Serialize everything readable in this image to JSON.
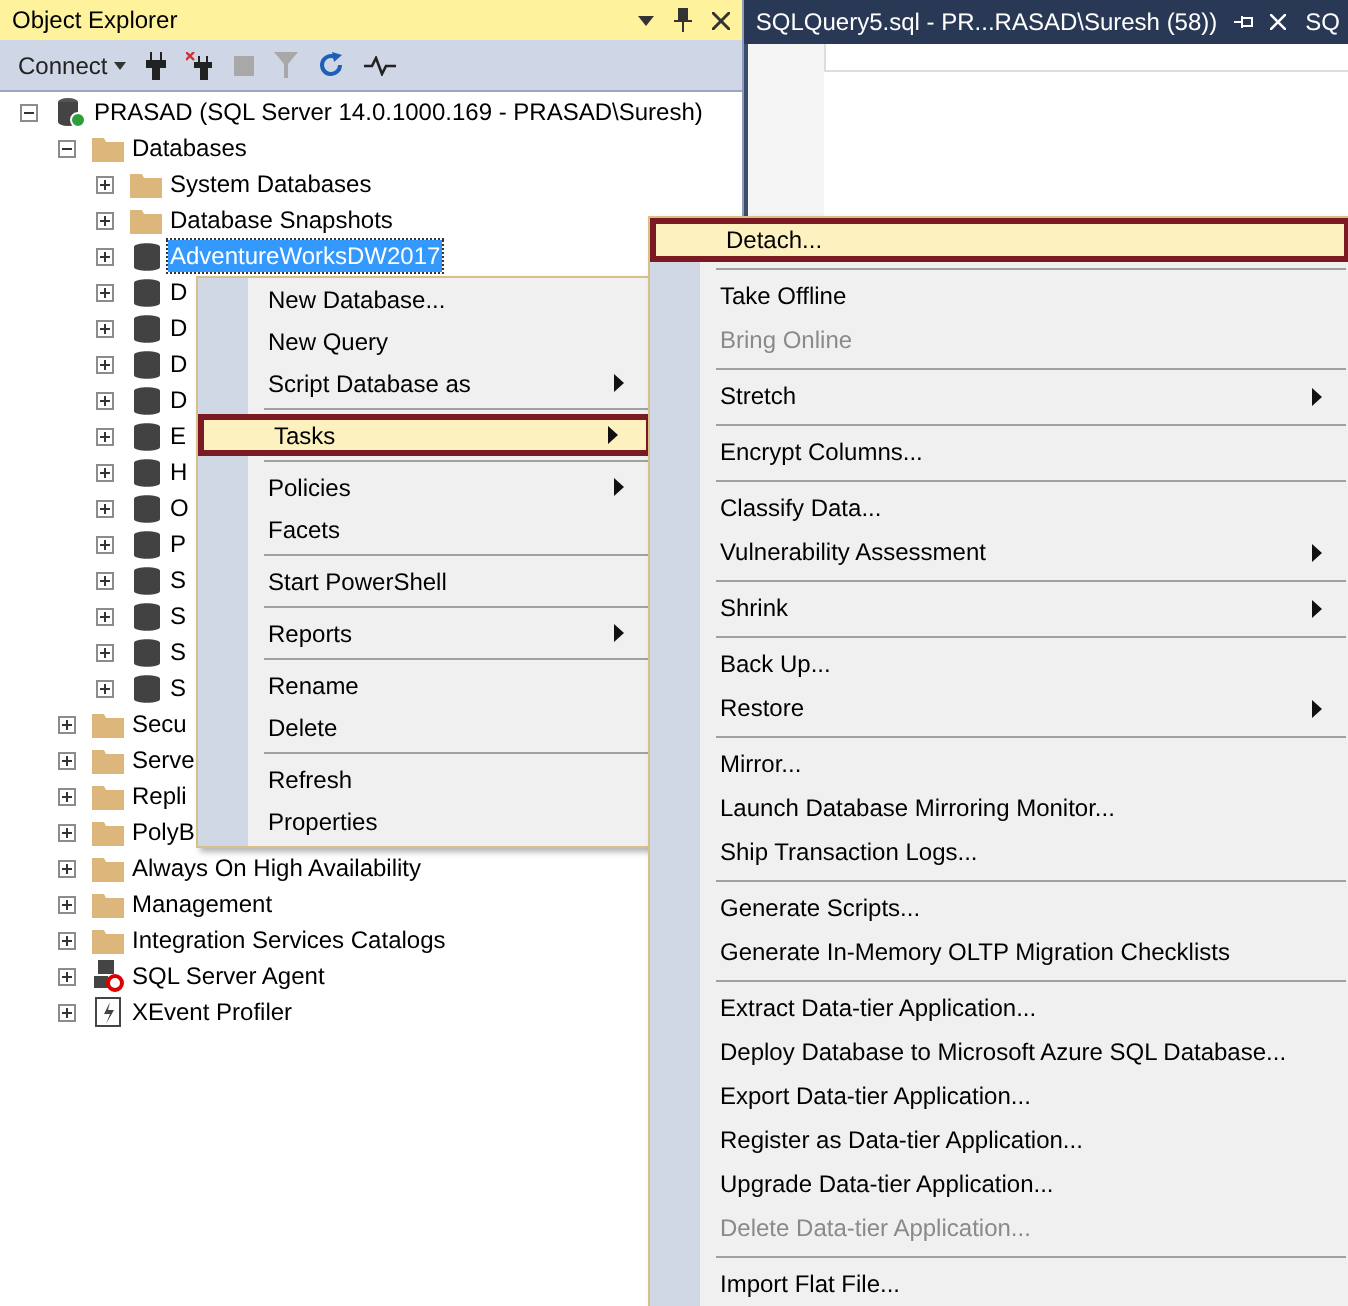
{
  "object_explorer": {
    "title": "Object Explorer",
    "connect": "Connect",
    "tree": [
      {
        "label": "PRASAD (SQL Server 14.0.1000.169 - PRASAD\\Suresh)",
        "kind": "server",
        "expanded": true,
        "selected": false,
        "children": [
          {
            "label": "Databases",
            "kind": "folder",
            "expanded": true,
            "selected": false,
            "children": [
              {
                "label": "System Databases",
                "kind": "folder",
                "expanded": false,
                "selected": false
              },
              {
                "label": "Database Snapshots",
                "kind": "folder",
                "expanded": false,
                "selected": false
              },
              {
                "label": "AdventureWorksDW2017",
                "kind": "database",
                "expanded": false,
                "selected": true
              },
              {
                "label": "D",
                "kind": "database",
                "expanded": false,
                "selected": false
              },
              {
                "label": "D",
                "kind": "database",
                "expanded": false,
                "selected": false
              },
              {
                "label": "D",
                "kind": "database",
                "expanded": false,
                "selected": false
              },
              {
                "label": "D",
                "kind": "database",
                "expanded": false,
                "selected": false
              },
              {
                "label": "E",
                "kind": "database",
                "expanded": false,
                "selected": false
              },
              {
                "label": "H",
                "kind": "database",
                "expanded": false,
                "selected": false
              },
              {
                "label": "O",
                "kind": "database",
                "expanded": false,
                "selected": false
              },
              {
                "label": "P",
                "kind": "database",
                "expanded": false,
                "selected": false
              },
              {
                "label": "S",
                "kind": "database",
                "expanded": false,
                "selected": false
              },
              {
                "label": "S",
                "kind": "database",
                "expanded": false,
                "selected": false
              },
              {
                "label": "S",
                "kind": "database",
                "expanded": false,
                "selected": false
              },
              {
                "label": "S",
                "kind": "database",
                "expanded": false,
                "selected": false
              }
            ]
          },
          {
            "label": "Secu",
            "kind": "folder",
            "expanded": false,
            "selected": false
          },
          {
            "label": "Serve",
            "kind": "folder",
            "expanded": false,
            "selected": false
          },
          {
            "label": "Repli",
            "kind": "folder",
            "expanded": false,
            "selected": false
          },
          {
            "label": "PolyB",
            "kind": "folder",
            "expanded": false,
            "selected": false
          },
          {
            "label": "Always On High Availability",
            "kind": "folder",
            "expanded": false,
            "selected": false
          },
          {
            "label": "Management",
            "kind": "folder",
            "expanded": false,
            "selected": false
          },
          {
            "label": "Integration Services Catalogs",
            "kind": "folder",
            "expanded": false,
            "selected": false
          },
          {
            "label": "SQL Server Agent",
            "kind": "agent",
            "expanded": false,
            "selected": false
          },
          {
            "label": "XEvent Profiler",
            "kind": "xevent",
            "expanded": false,
            "selected": false
          }
        ]
      }
    ]
  },
  "editor_tabs": [
    {
      "label": "SQLQuery5.sql - PR...RASAD\\Suresh (58))"
    },
    {
      "label": "SQ"
    }
  ],
  "context_menu": [
    {
      "kind": "item",
      "label": "New Database...",
      "submenu": false,
      "selected": false,
      "disabled": false
    },
    {
      "kind": "item",
      "label": "New Query",
      "submenu": false,
      "selected": false,
      "disabled": false
    },
    {
      "kind": "item",
      "label": "Script Database as",
      "submenu": true,
      "selected": false,
      "disabled": false
    },
    {
      "kind": "separator"
    },
    {
      "kind": "item",
      "label": "Tasks",
      "submenu": true,
      "selected": true,
      "disabled": false
    },
    {
      "kind": "separator"
    },
    {
      "kind": "item",
      "label": "Policies",
      "submenu": true,
      "selected": false,
      "disabled": false
    },
    {
      "kind": "item",
      "label": "Facets",
      "submenu": false,
      "selected": false,
      "disabled": false
    },
    {
      "kind": "separator"
    },
    {
      "kind": "item",
      "label": "Start PowerShell",
      "submenu": false,
      "selected": false,
      "disabled": false
    },
    {
      "kind": "separator"
    },
    {
      "kind": "item",
      "label": "Reports",
      "submenu": true,
      "selected": false,
      "disabled": false
    },
    {
      "kind": "separator"
    },
    {
      "kind": "item",
      "label": "Rename",
      "submenu": false,
      "selected": false,
      "disabled": false
    },
    {
      "kind": "item",
      "label": "Delete",
      "submenu": false,
      "selected": false,
      "disabled": false
    },
    {
      "kind": "separator"
    },
    {
      "kind": "item",
      "label": "Refresh",
      "submenu": false,
      "selected": false,
      "disabled": false
    },
    {
      "kind": "item",
      "label": "Properties",
      "submenu": false,
      "selected": false,
      "disabled": false
    }
  ],
  "tasks_submenu": [
    {
      "kind": "item",
      "label": "Detach...",
      "submenu": false,
      "selected": true,
      "disabled": false
    },
    {
      "kind": "separator"
    },
    {
      "kind": "item",
      "label": "Take Offline",
      "submenu": false,
      "selected": false,
      "disabled": false
    },
    {
      "kind": "item",
      "label": "Bring Online",
      "submenu": false,
      "selected": false,
      "disabled": true
    },
    {
      "kind": "separator"
    },
    {
      "kind": "item",
      "label": "Stretch",
      "submenu": true,
      "selected": false,
      "disabled": false
    },
    {
      "kind": "separator"
    },
    {
      "kind": "item",
      "label": "Encrypt Columns...",
      "submenu": false,
      "selected": false,
      "disabled": false
    },
    {
      "kind": "separator"
    },
    {
      "kind": "item",
      "label": "Classify Data...",
      "submenu": false,
      "selected": false,
      "disabled": false
    },
    {
      "kind": "item",
      "label": "Vulnerability Assessment",
      "submenu": true,
      "selected": false,
      "disabled": false
    },
    {
      "kind": "separator"
    },
    {
      "kind": "item",
      "label": "Shrink",
      "submenu": true,
      "selected": false,
      "disabled": false
    },
    {
      "kind": "separator"
    },
    {
      "kind": "item",
      "label": "Back Up...",
      "submenu": false,
      "selected": false,
      "disabled": false
    },
    {
      "kind": "item",
      "label": "Restore",
      "submenu": true,
      "selected": false,
      "disabled": false
    },
    {
      "kind": "separator"
    },
    {
      "kind": "item",
      "label": "Mirror...",
      "submenu": false,
      "selected": false,
      "disabled": false
    },
    {
      "kind": "item",
      "label": "Launch Database Mirroring Monitor...",
      "submenu": false,
      "selected": false,
      "disabled": false
    },
    {
      "kind": "item",
      "label": "Ship Transaction Logs...",
      "submenu": false,
      "selected": false,
      "disabled": false
    },
    {
      "kind": "separator"
    },
    {
      "kind": "item",
      "label": "Generate Scripts...",
      "submenu": false,
      "selected": false,
      "disabled": false
    },
    {
      "kind": "item",
      "label": "Generate In-Memory OLTP Migration Checklists",
      "submenu": false,
      "selected": false,
      "disabled": false
    },
    {
      "kind": "separator"
    },
    {
      "kind": "item",
      "label": "Extract Data-tier Application...",
      "submenu": false,
      "selected": false,
      "disabled": false
    },
    {
      "kind": "item",
      "label": "Deploy Database to Microsoft Azure SQL Database...",
      "submenu": false,
      "selected": false,
      "disabled": false
    },
    {
      "kind": "item",
      "label": "Export Data-tier Application...",
      "submenu": false,
      "selected": false,
      "disabled": false
    },
    {
      "kind": "item",
      "label": "Register as Data-tier Application...",
      "submenu": false,
      "selected": false,
      "disabled": false
    },
    {
      "kind": "item",
      "label": "Upgrade Data-tier Application...",
      "submenu": false,
      "selected": false,
      "disabled": false
    },
    {
      "kind": "item",
      "label": "Delete Data-tier Application...",
      "submenu": false,
      "selected": false,
      "disabled": true
    },
    {
      "kind": "separator"
    },
    {
      "kind": "item",
      "label": "Import Flat File...",
      "submenu": false,
      "selected": false,
      "disabled": false
    }
  ]
}
